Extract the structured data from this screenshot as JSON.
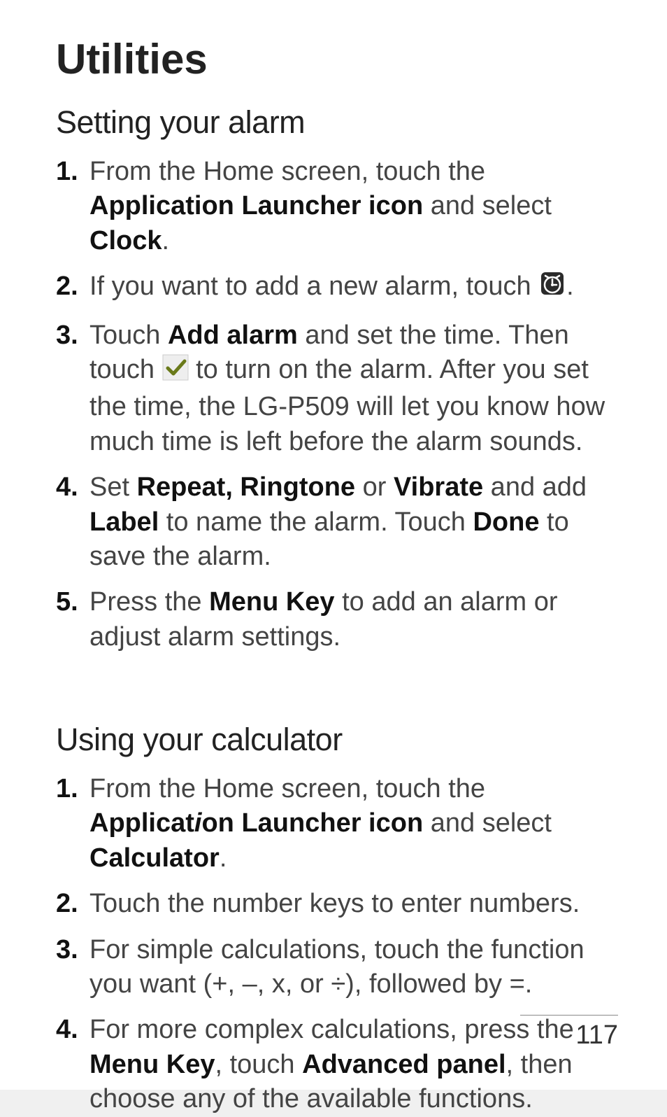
{
  "title": "Utilities",
  "section_alarm": {
    "heading": "Setting your alarm",
    "items": [
      {
        "pre": "From the Home screen, touch the ",
        "bold1": "Application Launcher icon",
        "mid": " and select ",
        "bold2": "Clock",
        "post": "."
      },
      {
        "pre": "If you want to add a new alarm, touch ",
        "post": "."
      },
      {
        "pre": "Touch ",
        "bold1": "Add alarm",
        "mid": " and set the time. Then touch ",
        "post": " to turn on the alarm. After you set the time, the LG-P509 will let you know how much time is left before the alarm sounds."
      },
      {
        "pre": "Set ",
        "bold1": "Repeat, Ringtone",
        "mid1": " or ",
        "bold2": "Vibrate",
        "mid2": " and add ",
        "bold3": "Label",
        "mid3": " to name the alarm. Touch ",
        "bold4": "Done",
        "post": " to save the alarm."
      },
      {
        "pre": "Press the ",
        "bold1": "Menu Key",
        "post": " to add an alarm or adjust alarm settings."
      }
    ]
  },
  "section_calc": {
    "heading": "Using your calculator",
    "items": [
      {
        "pre": "From the Home screen, touch the ",
        "bold1": "Applicat",
        "ital": "i",
        "bold1b": "on Launcher icon",
        "mid": " and select ",
        "bold2": "Calculator",
        "post": "."
      },
      {
        "pre": "Touch the number keys to enter numbers."
      },
      {
        "pre": "For simple calculations, touch the function you want (+, –, x, or ÷), followed by =."
      },
      {
        "pre": "For more complex calculations, press the ",
        "bold1": "Menu Key",
        "mid1": ", touch ",
        "bold2": "Advanced panel",
        "post": ", then choose any of the available functions."
      }
    ]
  },
  "page_number": "117"
}
